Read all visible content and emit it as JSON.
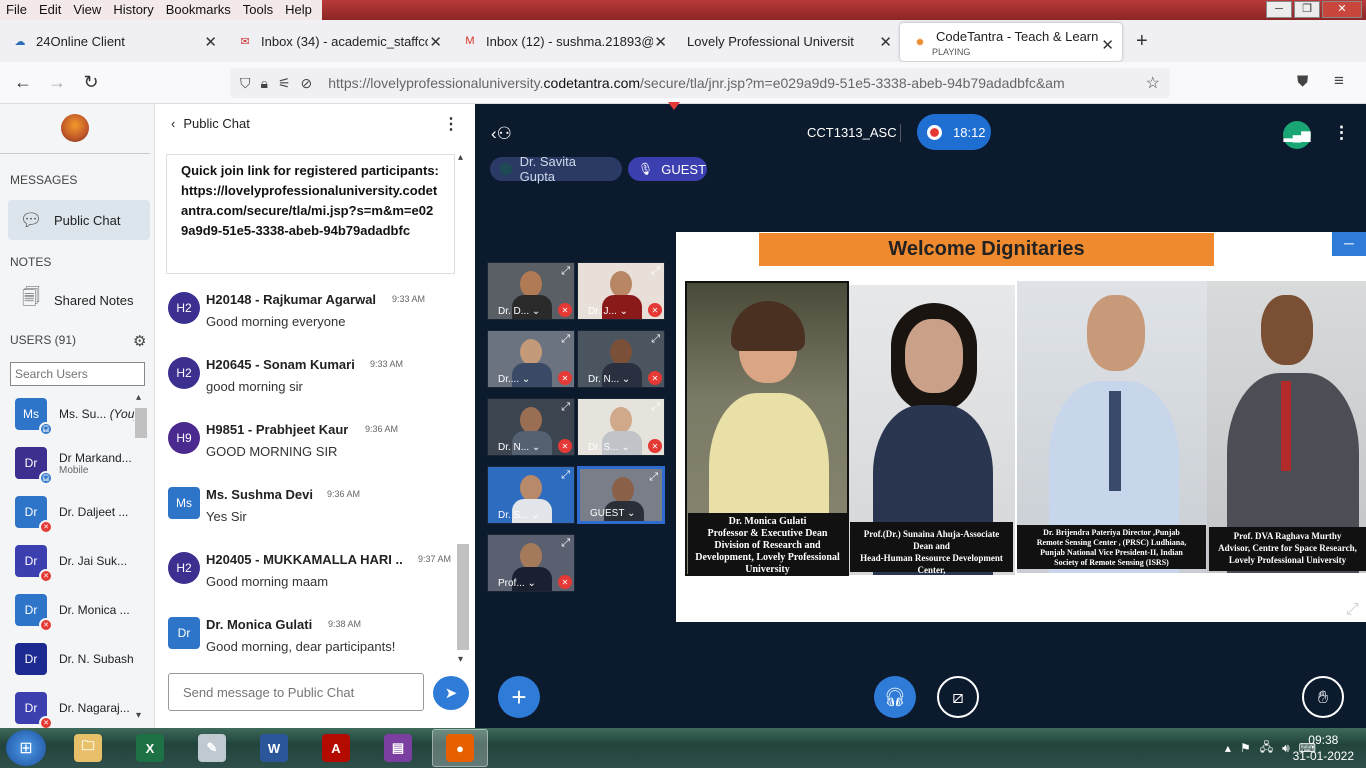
{
  "browser": {
    "menu": [
      "File",
      "Edit",
      "View",
      "History",
      "Bookmarks",
      "Tools",
      "Help"
    ],
    "tabs": [
      {
        "label": "24Online Client",
        "icon": "24online-icon"
      },
      {
        "label": "Inbox (34) - academic_staffcolle",
        "icon": "mail-icon"
      },
      {
        "label": "Inbox (12) - sushma.21893@lpu",
        "icon": "gmail-icon"
      },
      {
        "label": "Lovely Professional University :: Uni",
        "icon": ""
      },
      {
        "label": "CodeTantra - Teach & Learn Ar",
        "sub": "PLAYING",
        "icon": "codetantra-icon"
      }
    ],
    "url_prefix": "https://lovelyprofessionaluniversity.",
    "url_domain": "codetantra.com",
    "url_suffix": "/secure/tla/jnr.jsp?m=e029a9d9-51e5-3338-abeb-94b79adadbfc&am"
  },
  "sidebar": {
    "messages_label": "MESSAGES",
    "public_chat": "Public Chat",
    "notes_label": "NOTES",
    "shared_notes": "Shared Notes",
    "users_label": "USERS (91)",
    "search_placeholder": "Search Users",
    "users": [
      {
        "initials": "Ms",
        "name": "Ms. Su...",
        "tag": "(You)",
        "sub": "",
        "color": "#2e74c9",
        "badge": "audio"
      },
      {
        "initials": "Dr",
        "name": "Dr Markand...",
        "tag": "",
        "sub": "Mobile",
        "color": "#3b2f8f",
        "badge": "audio"
      },
      {
        "initials": "Dr",
        "name": "Dr. Daljeet ...",
        "tag": "",
        "sub": "",
        "color": "#2e74c9",
        "badge": "muted"
      },
      {
        "initials": "Dr",
        "name": "Dr. Jai Suk...",
        "tag": "",
        "sub": "",
        "color": "#3b3faf",
        "badge": "muted"
      },
      {
        "initials": "Dr",
        "name": "Dr. Monica ...",
        "tag": "",
        "sub": "",
        "color": "#2e74c9",
        "badge": "muted"
      },
      {
        "initials": "Dr",
        "name": "Dr. N. Subash",
        "tag": "",
        "sub": "",
        "color": "#1d2a8f",
        "badge": ""
      },
      {
        "initials": "Dr",
        "name": "Dr. Nagaraj...",
        "tag": "",
        "sub": "",
        "color": "#3b3faf",
        "badge": "muted"
      }
    ]
  },
  "chat": {
    "title": "Public Chat",
    "pinned": "Quick join link for registered participants: https://lovelyprofessionaluniversity.codetantra.com/secure/tla/mi.jsp?s=m&m=e029a9d9-51e5-3338-abeb-94b79adadbfc",
    "messages": [
      {
        "initials": "H2",
        "name": "H20148 - Rajkumar Agarwal",
        "time": "9:33 AM",
        "text": "Good morning everyone",
        "color": "#3b2f8f"
      },
      {
        "initials": "H2",
        "name": "H20645 - Sonam Kumari",
        "time": "9:33 AM",
        "text": "good morning sir",
        "color": "#3b2f8f"
      },
      {
        "initials": "H9",
        "name": "H9851 - Prabhjeet Kaur",
        "time": "9:36 AM",
        "text": "GOOD MORNING SIR",
        "color": "#4a2a8f"
      },
      {
        "initials": "Ms",
        "name": "Ms. Sushma Devi",
        "time": "9:36 AM",
        "text": "Yes Sir",
        "color": "#2e74c9"
      },
      {
        "initials": "H2",
        "name": "H20405 - MUKKAMALLA HARI ...",
        "time": "9:37 AM",
        "text": "Good morning maam",
        "color": "#3b2f8f"
      },
      {
        "initials": "Dr",
        "name": "Dr. Monica Gulati",
        "time": "9:38 AM",
        "text": "Good morning, dear participants!",
        "color": "#2e74c9"
      }
    ],
    "input_placeholder": "Send message to Public Chat"
  },
  "conference": {
    "room": "CCT1313_ASC",
    "timer": "18:12",
    "presenter": "Dr. Savita Gupta",
    "role": "GUEST",
    "tiles": [
      {
        "name": "Dr. D...",
        "muted": true
      },
      {
        "name": "Dr. J...",
        "muted": true
      },
      {
        "name": "Dr....",
        "muted": true
      },
      {
        "name": "Dr. N...",
        "muted": true
      },
      {
        "name": "Dr. N...",
        "muted": true
      },
      {
        "name": "Dr. S...",
        "muted": true
      },
      {
        "name": "Dr. S...",
        "muted": false
      },
      {
        "name": "GUEST",
        "muted": false
      },
      {
        "name": "Prof...",
        "muted": true
      }
    ],
    "slide": {
      "title": "Welcome  Dignitaries",
      "captions": [
        "Dr. Monica Gulati\nProfessor & Executive Dean\nDivision of Research and\nDevelopment, Lovely Professional\nUniversity",
        "Prof.(Dr.) Sunaina Ahuja-Associate Dean and\nHead-Human Resource Development Center,\nLovely Professional University",
        "Dr. Brijendra Pateriya Director ,Punjab\nRemote Sensing Center , (PRSC) Ludhiana,\nPunjab National Vice President-II, Indian\nSociety of Remote Sensing (ISRS)",
        "Prof. DVA Raghava Murthy\nAdvisor, Centre for Space Research,\nLovely Professional University"
      ]
    }
  },
  "taskbar": {
    "apps": [
      "explorer-icon",
      "excel-icon",
      "paint-icon",
      "word-icon",
      "acrobat-icon",
      "winrar-icon",
      "firefox-icon"
    ],
    "time": "09:38",
    "date": "31-01-2022"
  }
}
